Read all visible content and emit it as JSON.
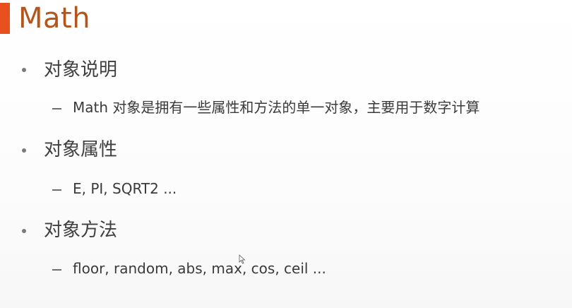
{
  "slide": {
    "title": "Math",
    "accent_color": "#e8501e",
    "title_color": "#b4551c",
    "bullets": [
      {
        "text": "对象说明",
        "sub": "Math 对象是拥有一些属性和方法的单一对象，主要用于数字计算"
      },
      {
        "text": "对象属性",
        "sub": "E, PI, SQRT2 ..."
      },
      {
        "text": "对象方法",
        "sub": "floor, random, abs, max, cos, ceil ..."
      }
    ]
  }
}
